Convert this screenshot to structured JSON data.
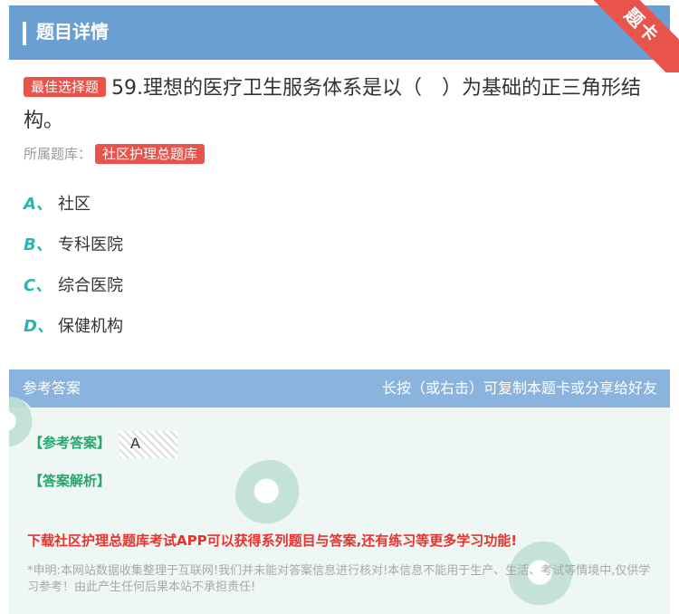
{
  "header": {
    "title": "题目详情",
    "ribbon": "题卡"
  },
  "question": {
    "type_tag": "最佳选择题",
    "text": "59.理想的医疗卫生服务体系是以（　）为基础的正三角形结构。"
  },
  "bank": {
    "label": "所属题库：",
    "name": "社区护理总题库"
  },
  "options": [
    {
      "letter": "A、",
      "text": "社区"
    },
    {
      "letter": "B、",
      "text": "专科医院"
    },
    {
      "letter": "C、",
      "text": "综合医院"
    },
    {
      "letter": "D、",
      "text": "保健机构"
    }
  ],
  "answer": {
    "panel_title": "参考答案",
    "copy_hint": "长按（或右击）可复制本题卡或分享给好友",
    "ref_label": "【参考答案】",
    "ref_value": "A",
    "analysis_label": "【答案解析】",
    "promo": "下载社区护理总题库考试APP可以获得系列题目与答案,还有练习等更多学习功能!",
    "disclaimer": "*申明:本网站数据收集整理于互联网!我们并未能对答案信息进行核对!本信息不能用于生产、生活、考试等情境中,仅供学习参考！由此产生任何后果本站不承担责任!"
  },
  "colors": {
    "header": "#6a9fd2",
    "accent_red": "#e8534b",
    "option_letter": "#2bb5b0",
    "answer_green": "#22a86a",
    "promo_red": "#e8322b"
  }
}
